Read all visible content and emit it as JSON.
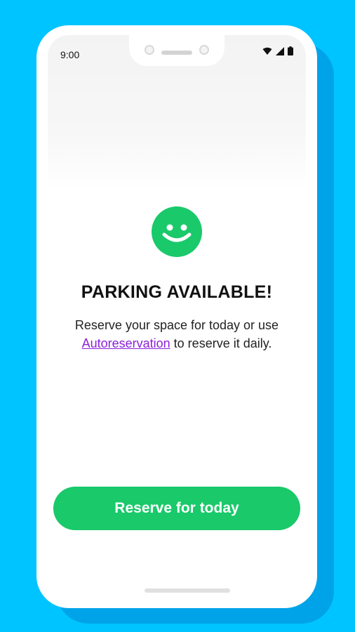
{
  "status_bar": {
    "time": "9:00",
    "icons": [
      "wifi-icon",
      "signal-icon",
      "battery-icon"
    ]
  },
  "main": {
    "illustration": "smiley-face-icon",
    "title": "PARKING AVAILABLE!",
    "description_before_link": "Reserve your space for today or use ",
    "link_text": "Autoreservation",
    "description_after_link": " to reserve it daily."
  },
  "actions": {
    "reserve_label": "Reserve for today"
  },
  "colors": {
    "background": "#00c4ff",
    "accent_green": "#19c96a",
    "link_purple": "#8b1fd9"
  }
}
